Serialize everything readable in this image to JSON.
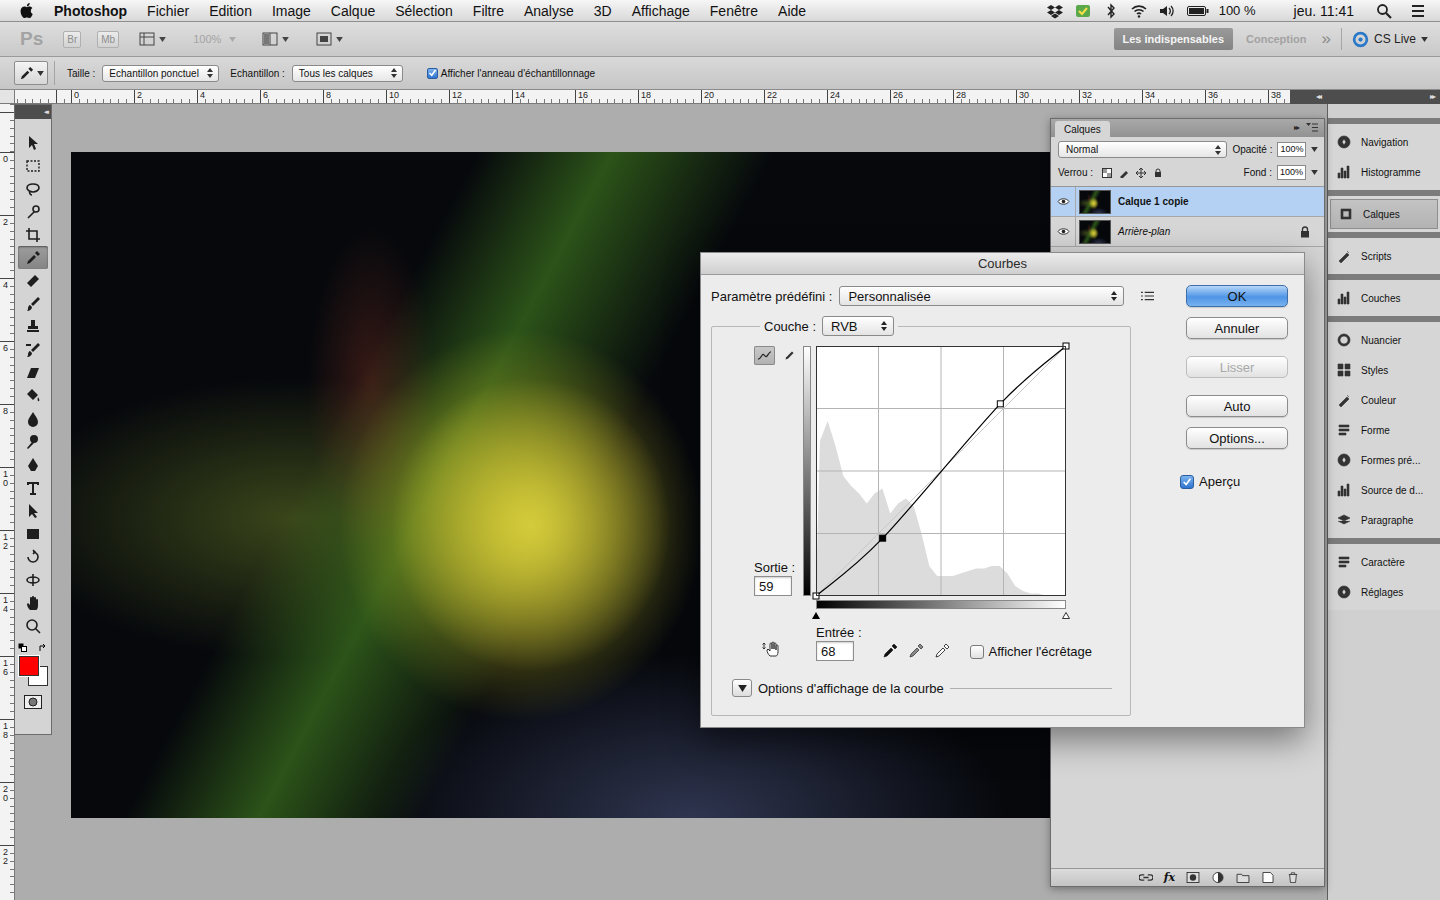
{
  "menubar": {
    "app": "Photoshop",
    "menus": [
      "Fichier",
      "Edition",
      "Image",
      "Calque",
      "Sélection",
      "Filtre",
      "Analyse",
      "3D",
      "Affichage",
      "Fenêtre",
      "Aide"
    ],
    "battery": "100 %",
    "clock": "jeu. 11:41"
  },
  "appbar": {
    "logo": "Ps",
    "bridge": "Br",
    "minibridge": "Mb",
    "zoom": {
      "value": "100%",
      "disabled": true
    },
    "workspaces": [
      {
        "label": "Les indispensables",
        "selected": true
      },
      {
        "label": "Conception",
        "selected": false
      }
    ],
    "more": "»",
    "cslive": "CS Live"
  },
  "options": {
    "size_label": "Taille :",
    "size_value": "Echantillon ponctuel",
    "sample_label": "Echantillon :",
    "sample_value": "Tous les calques",
    "ring": {
      "label": "Afficher l'anneau d'échantillonnage",
      "checked": true
    }
  },
  "rulers": {
    "horizontal": [
      "0",
      "2",
      "4",
      "6",
      "8",
      "10",
      "12",
      "14",
      "16",
      "18",
      "20",
      "22",
      "24",
      "26",
      "28",
      "30",
      "32",
      "34",
      "36",
      "38"
    ],
    "vertical": [
      "0",
      "2",
      "4",
      "6",
      "8",
      "10",
      "12",
      "14",
      "16",
      "18",
      "20",
      "22"
    ]
  },
  "toolbar": {
    "collapse": "◂◂",
    "tools": [
      {
        "kind": "move",
        "selected": false
      },
      {
        "kind": "marquee",
        "selected": false
      },
      {
        "kind": "lasso",
        "selected": false
      },
      {
        "kind": "quick-select",
        "selected": false
      },
      {
        "kind": "crop",
        "selected": false
      },
      {
        "kind": "eyedropper",
        "selected": true
      },
      {
        "kind": "heal",
        "selected": false
      },
      {
        "kind": "brush",
        "selected": false
      },
      {
        "kind": "stamp",
        "selected": false
      },
      {
        "kind": "history-brush",
        "selected": false
      },
      {
        "kind": "eraser",
        "selected": false
      },
      {
        "kind": "bucket",
        "selected": false
      },
      {
        "kind": "blur",
        "selected": false
      },
      {
        "kind": "dodge",
        "selected": false
      },
      {
        "kind": "pen",
        "selected": false
      },
      {
        "kind": "type",
        "selected": false
      },
      {
        "kind": "path-select",
        "selected": false
      },
      {
        "kind": "shape",
        "selected": false
      },
      {
        "kind": "3d-rotate",
        "selected": false
      },
      {
        "kind": "3d-orbit",
        "selected": false
      },
      {
        "kind": "hand",
        "selected": false
      },
      {
        "kind": "zoom",
        "selected": false
      }
    ],
    "foreground": "#ff0000",
    "background": "#ffffff"
  },
  "layers_panel": {
    "tab": "Calques",
    "collapse": "▸▸",
    "blend": "Normal",
    "opacity_label": "Opacité :",
    "opacity": "100%",
    "lock_label": "Verrou :",
    "fill_label": "Fond :",
    "fill": "100%",
    "effects": "fx",
    "layers": [
      {
        "name": "Calque 1 copie",
        "kind": "layer",
        "selected": true,
        "visible": true,
        "locked": false
      },
      {
        "name": "Arrière-plan",
        "kind": "background",
        "selected": false,
        "visible": true,
        "locked": true
      }
    ]
  },
  "dock": {
    "collapse": "◂◂",
    "expand": "▸▸",
    "groups": [
      {
        "items": [
          {
            "label": "Navigation",
            "selected": false
          },
          {
            "label": "Histogramme",
            "selected": false
          }
        ]
      },
      {
        "items": [
          {
            "label": "Calques",
            "selected": true
          }
        ]
      },
      {
        "items": [
          {
            "label": "Scripts",
            "selected": false
          }
        ]
      },
      {
        "items": [
          {
            "label": "Couches",
            "selected": false
          }
        ]
      },
      {
        "items": [
          {
            "label": "Nuancier",
            "selected": false
          },
          {
            "label": "Styles",
            "selected": false
          },
          {
            "label": "Couleur",
            "selected": false
          },
          {
            "label": "Forme",
            "selected": false
          },
          {
            "label": "Formes pré...",
            "selected": false
          },
          {
            "label": "Source de d...",
            "selected": false
          },
          {
            "label": "Paragraphe",
            "selected": false
          }
        ]
      },
      {
        "items": [
          {
            "label": "Caractère",
            "selected": false
          },
          {
            "label": "Réglages",
            "selected": false
          }
        ]
      }
    ]
  },
  "dialog": {
    "title": "Courbes",
    "preset_label": "Paramètre prédéfini :",
    "preset": "Personnalisée",
    "channel_label": "Couche :",
    "channel": "RVB",
    "edit_modes": [
      {
        "kind": "curve",
        "selected": true
      },
      {
        "kind": "pencil",
        "selected": false
      }
    ],
    "output_label": "Sortie :",
    "output": "59",
    "input_label": "Entrée :",
    "input": "68",
    "clipping": {
      "label": "Afficher l'écrêtage",
      "checked": false
    },
    "display_options": "Options d'affichage de la courbe",
    "button_groups": [
      [
        {
          "label": "OK",
          "default": true,
          "disabled": false
        },
        {
          "label": "Annuler",
          "default": false,
          "disabled": false
        }
      ],
      [
        {
          "label": "Lisser",
          "default": false,
          "disabled": true
        }
      ],
      [
        {
          "label": "Auto",
          "default": false,
          "disabled": false
        },
        {
          "label": "Options...",
          "default": false,
          "disabled": false
        }
      ]
    ],
    "preview": {
      "label": "Aperçu",
      "checked": true
    },
    "curve": {
      "points": [
        [
          0,
          0
        ],
        [
          68,
          59
        ],
        [
          188,
          196
        ],
        [
          255,
          255
        ]
      ],
      "selected_point": 1
    },
    "histogram": [
      62,
      70,
      60,
      48,
      44,
      41,
      37,
      41,
      43,
      33,
      37,
      39,
      36,
      25,
      12,
      8,
      8,
      8,
      9,
      10,
      11,
      11,
      12,
      12,
      9,
      4,
      2,
      1,
      1,
      0,
      0,
      0
    ]
  }
}
